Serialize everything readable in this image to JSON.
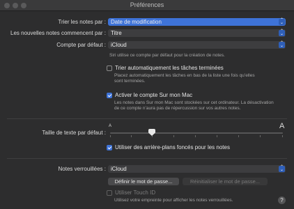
{
  "window": {
    "title": "Préférences"
  },
  "sort": {
    "label": "Trier les notes par :",
    "value": "Date de modification"
  },
  "new_notes": {
    "label": "Les nouvelles notes commencent par :",
    "value": "Titre"
  },
  "default_account": {
    "label": "Compte par défaut :",
    "value": "iCloud",
    "hint": "Siri utilise ce compte par défaut pour la création de notes."
  },
  "auto_sort": {
    "label": "Trier automatiquement les tâches terminées",
    "checked": false,
    "hint_line1": "Placez automatiquement les tâches en bas de la liste une fois qu’elles",
    "hint_line2": "sont terminées."
  },
  "on_my_mac": {
    "label": "Activer le compte Sur mon Mac",
    "checked": true,
    "hint_line1": "Les notes dans Sur mon Mac sont stockées sur cet ordinateur. La désactivation",
    "hint_line2": "de ce compte n’aura pas de répercussion sur vos autres notes."
  },
  "text_size": {
    "label": "Taille de texte par défaut :",
    "small_glyph": "A",
    "large_glyph": "A",
    "level": 0.24
  },
  "dark_bg": {
    "label": "Utiliser des arrière-plans foncés pour les notes",
    "checked": true
  },
  "locked_notes": {
    "label": "Notes verrouillées :",
    "value": "iCloud",
    "set_password_label": "Définir le mot de passe...",
    "reset_password_label": "Réinitialiser le mot de passe...",
    "touch_id_label": "Utiliser Touch ID",
    "touch_id_hint": "Utilisez votre empreinte pour afficher les notes verrouillées."
  },
  "help": {
    "label": "?"
  },
  "icons": {
    "popup_chevron": "chevron-up-down-icon",
    "check": "checkmark-icon"
  },
  "colors": {
    "accent": "#3e73d8",
    "background": "#2d2d2e"
  }
}
